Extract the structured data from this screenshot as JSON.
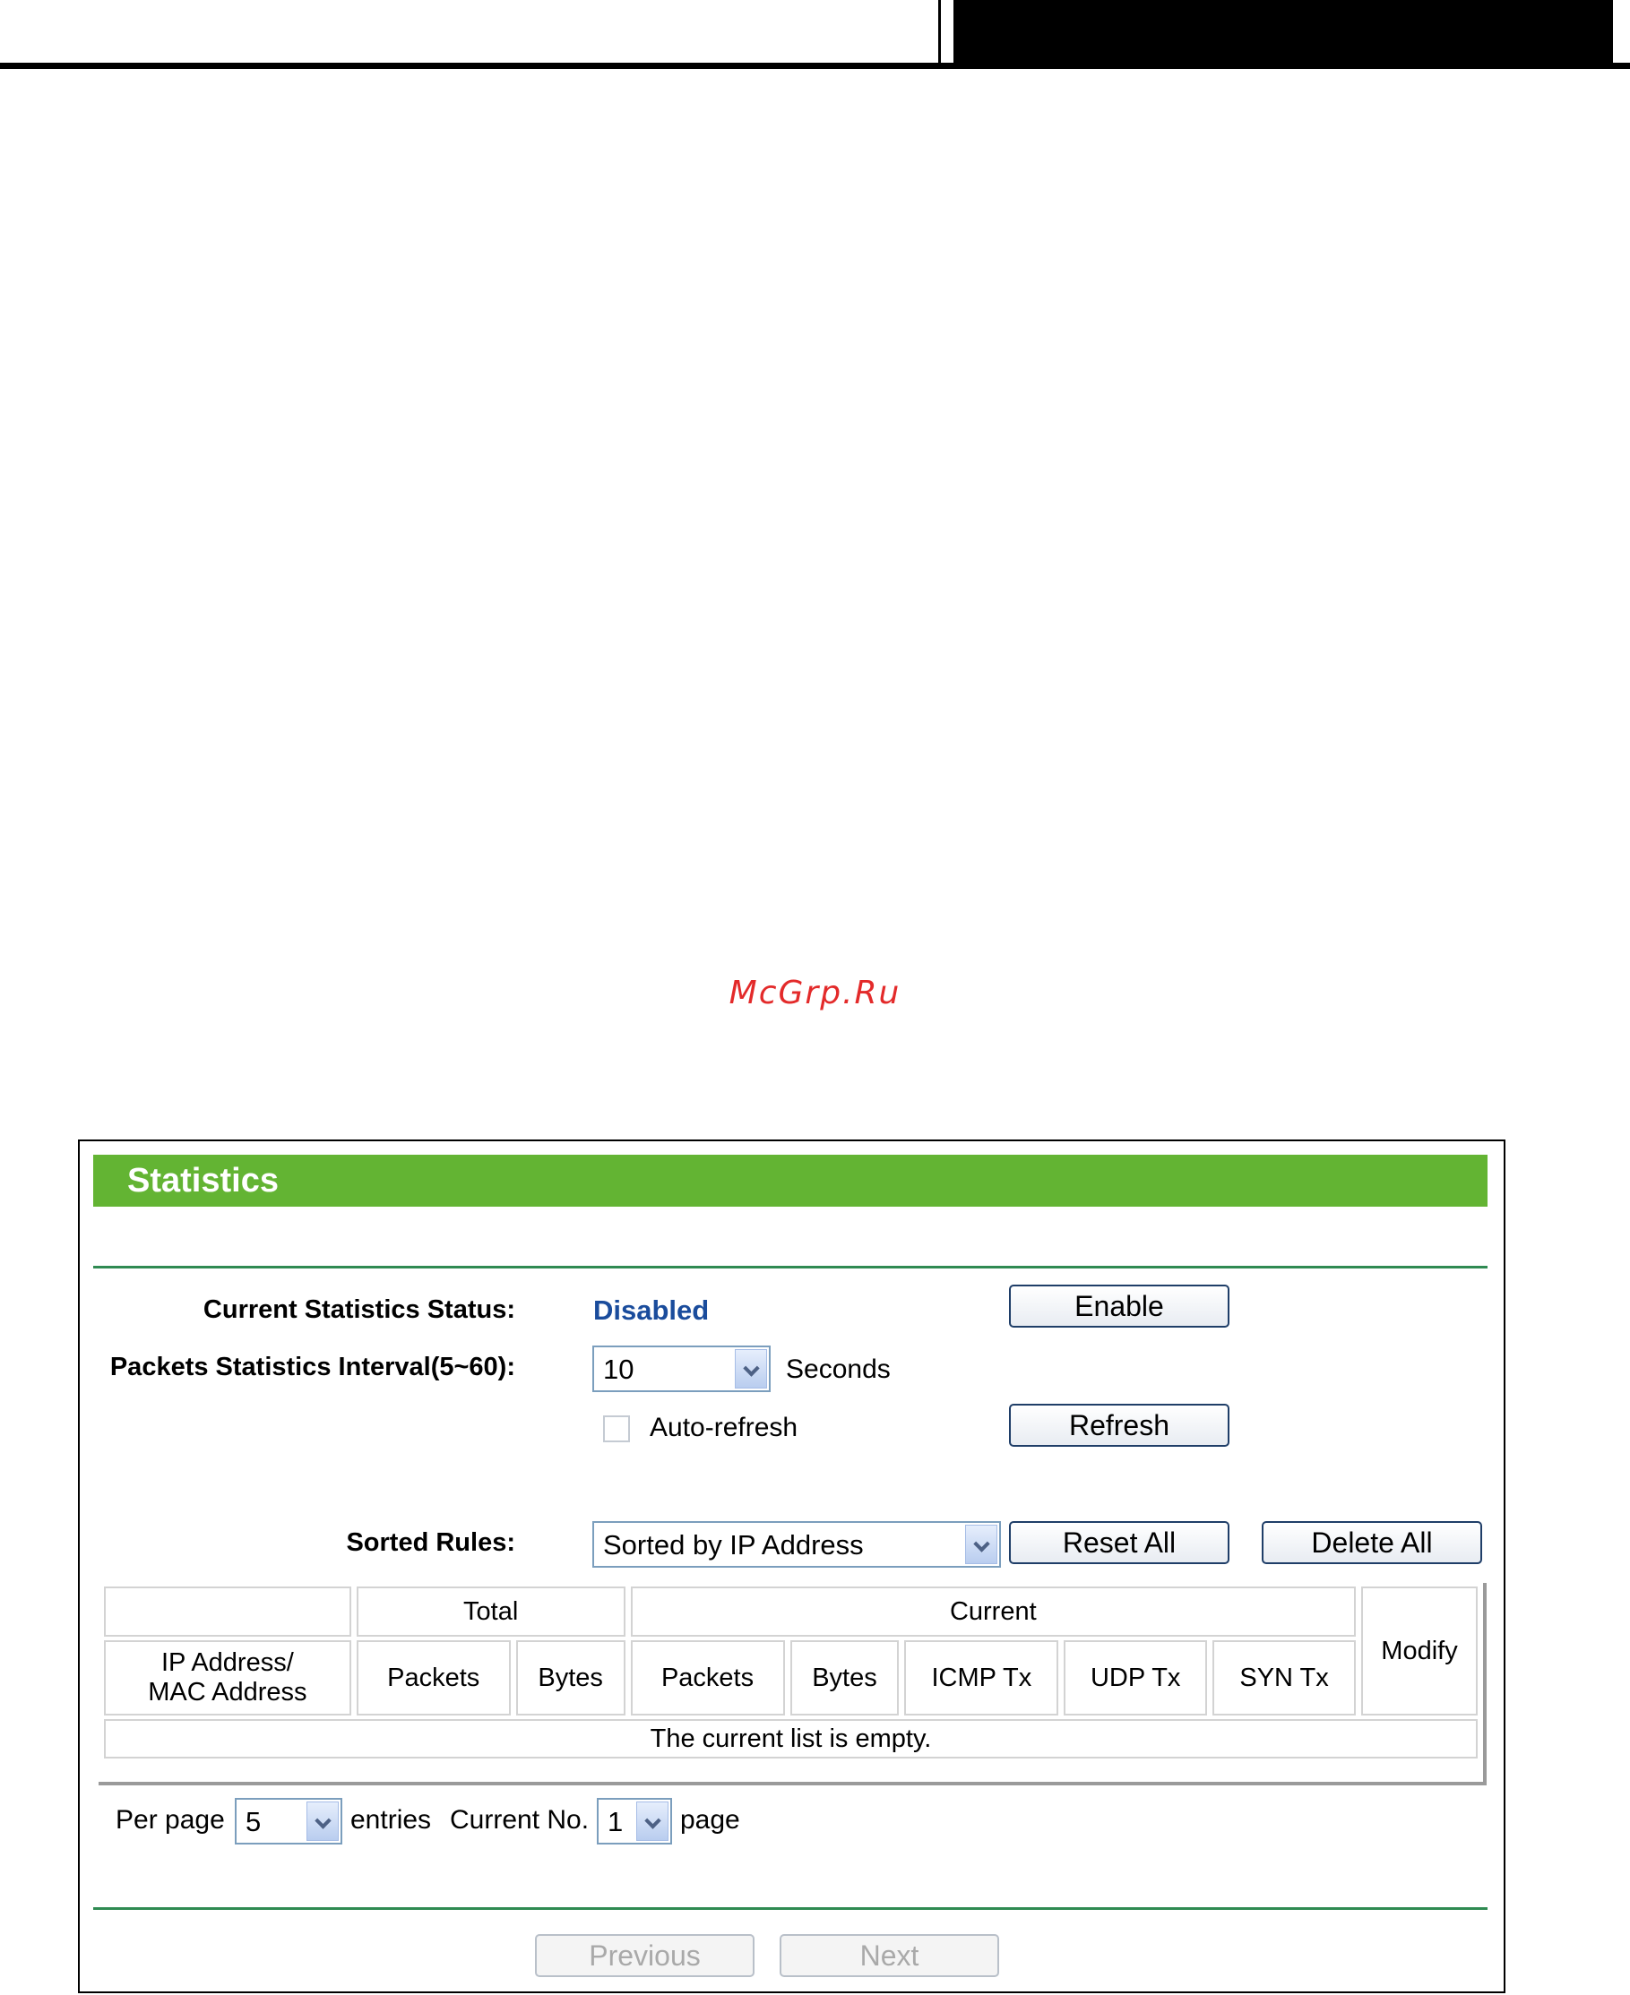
{
  "watermark": "McGrp.Ru",
  "panel": {
    "title": "Statistics",
    "status_label": "Current Statistics Status:",
    "status_value": "Disabled",
    "enable_button": "Enable",
    "interval_label": "Packets Statistics Interval(5~60):",
    "interval_value": "10",
    "interval_unit": "Seconds",
    "auto_refresh_label": "Auto-refresh",
    "refresh_button": "Refresh",
    "sorted_label": "Sorted Rules:",
    "sorted_value": "Sorted by IP Address",
    "reset_all_button": "Reset All",
    "delete_all_button": "Delete All"
  },
  "table": {
    "group_total": "Total",
    "group_current": "Current",
    "modify": "Modify",
    "ip_mac": [
      "IP Address/",
      "MAC Address"
    ],
    "columns": [
      "Packets",
      "Bytes",
      "Packets",
      "Bytes",
      "ICMP Tx",
      "UDP Tx",
      "SYN Tx"
    ],
    "empty_message": "The current list is empty."
  },
  "pager": {
    "per_page_label": "Per page",
    "per_page_value": "5",
    "entries_label": "entries",
    "current_no_label": "Current No.",
    "current_no_value": "1",
    "page_label": "page",
    "previous_button": "Previous",
    "next_button": "Next"
  },
  "colors": {
    "title_bar": "#63b433",
    "status_value": "#1a4c9c",
    "watermark": "#e32a2a",
    "rule": "#2f8a52"
  }
}
